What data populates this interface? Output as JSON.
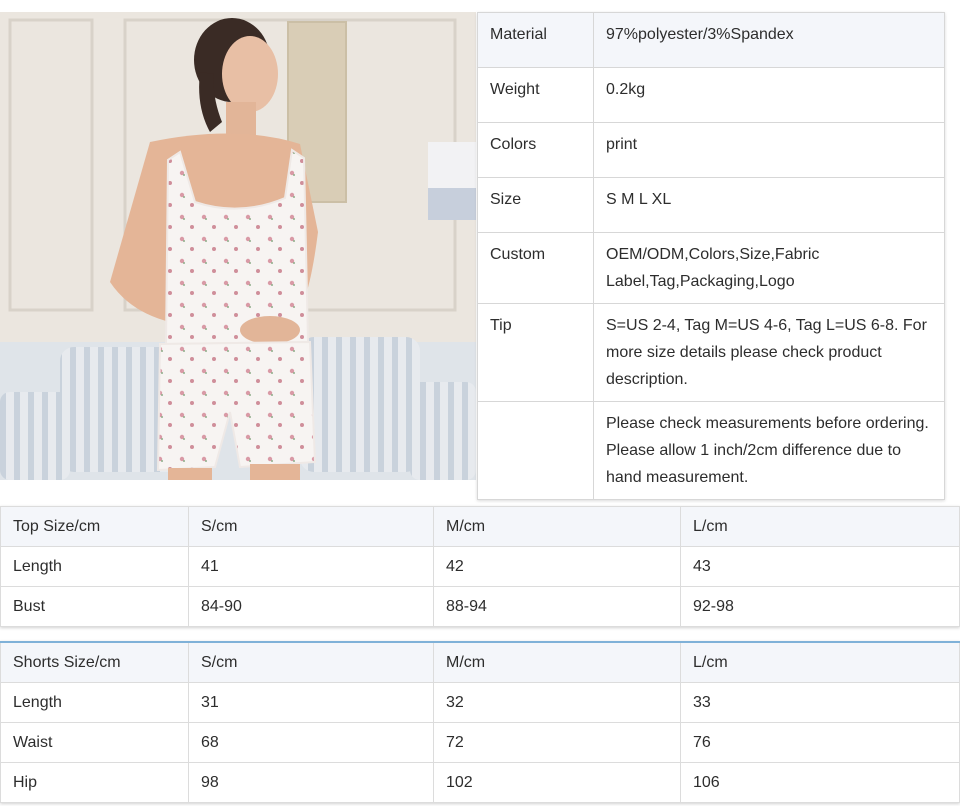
{
  "photo": {
    "alt": "model wearing floral print ribbed cami top and shorts set"
  },
  "spec": [
    {
      "label": "Material",
      "value": "97%polyester/3%Spandex"
    },
    {
      "label": "Weight",
      "value": "0.2kg"
    },
    {
      "label": "Colors",
      "value": "print"
    },
    {
      "label": "Size",
      "value": "S M L XL"
    },
    {
      "label": "Custom",
      "value": "OEM/ODM,Colors,Size,Fabric Label,Tag,Packaging,Logo"
    },
    {
      "label": "Tip",
      "value": "S=US 2-4, Tag M=US 4-6, Tag L=US 6-8. For more size details please check product description."
    },
    {
      "label": "",
      "value": "Please check measurements before ordering. Please allow 1 inch/2cm difference due to hand measurement."
    }
  ],
  "top_table": {
    "header": [
      "Top Size/cm",
      "S/cm",
      "M/cm",
      "L/cm"
    ],
    "rows": [
      [
        "Length",
        "41",
        "42",
        "43"
      ],
      [
        "Bust",
        "84-90",
        "88-94",
        "92-98"
      ]
    ]
  },
  "shorts_table": {
    "header": [
      "Shorts Size/cm",
      "S/cm",
      "M/cm",
      "L/cm"
    ],
    "rows": [
      [
        "Length",
        "31",
        "32",
        "33"
      ],
      [
        "Waist",
        "68",
        "72",
        "76"
      ],
      [
        "Hip",
        "98",
        "102",
        "106"
      ]
    ]
  }
}
